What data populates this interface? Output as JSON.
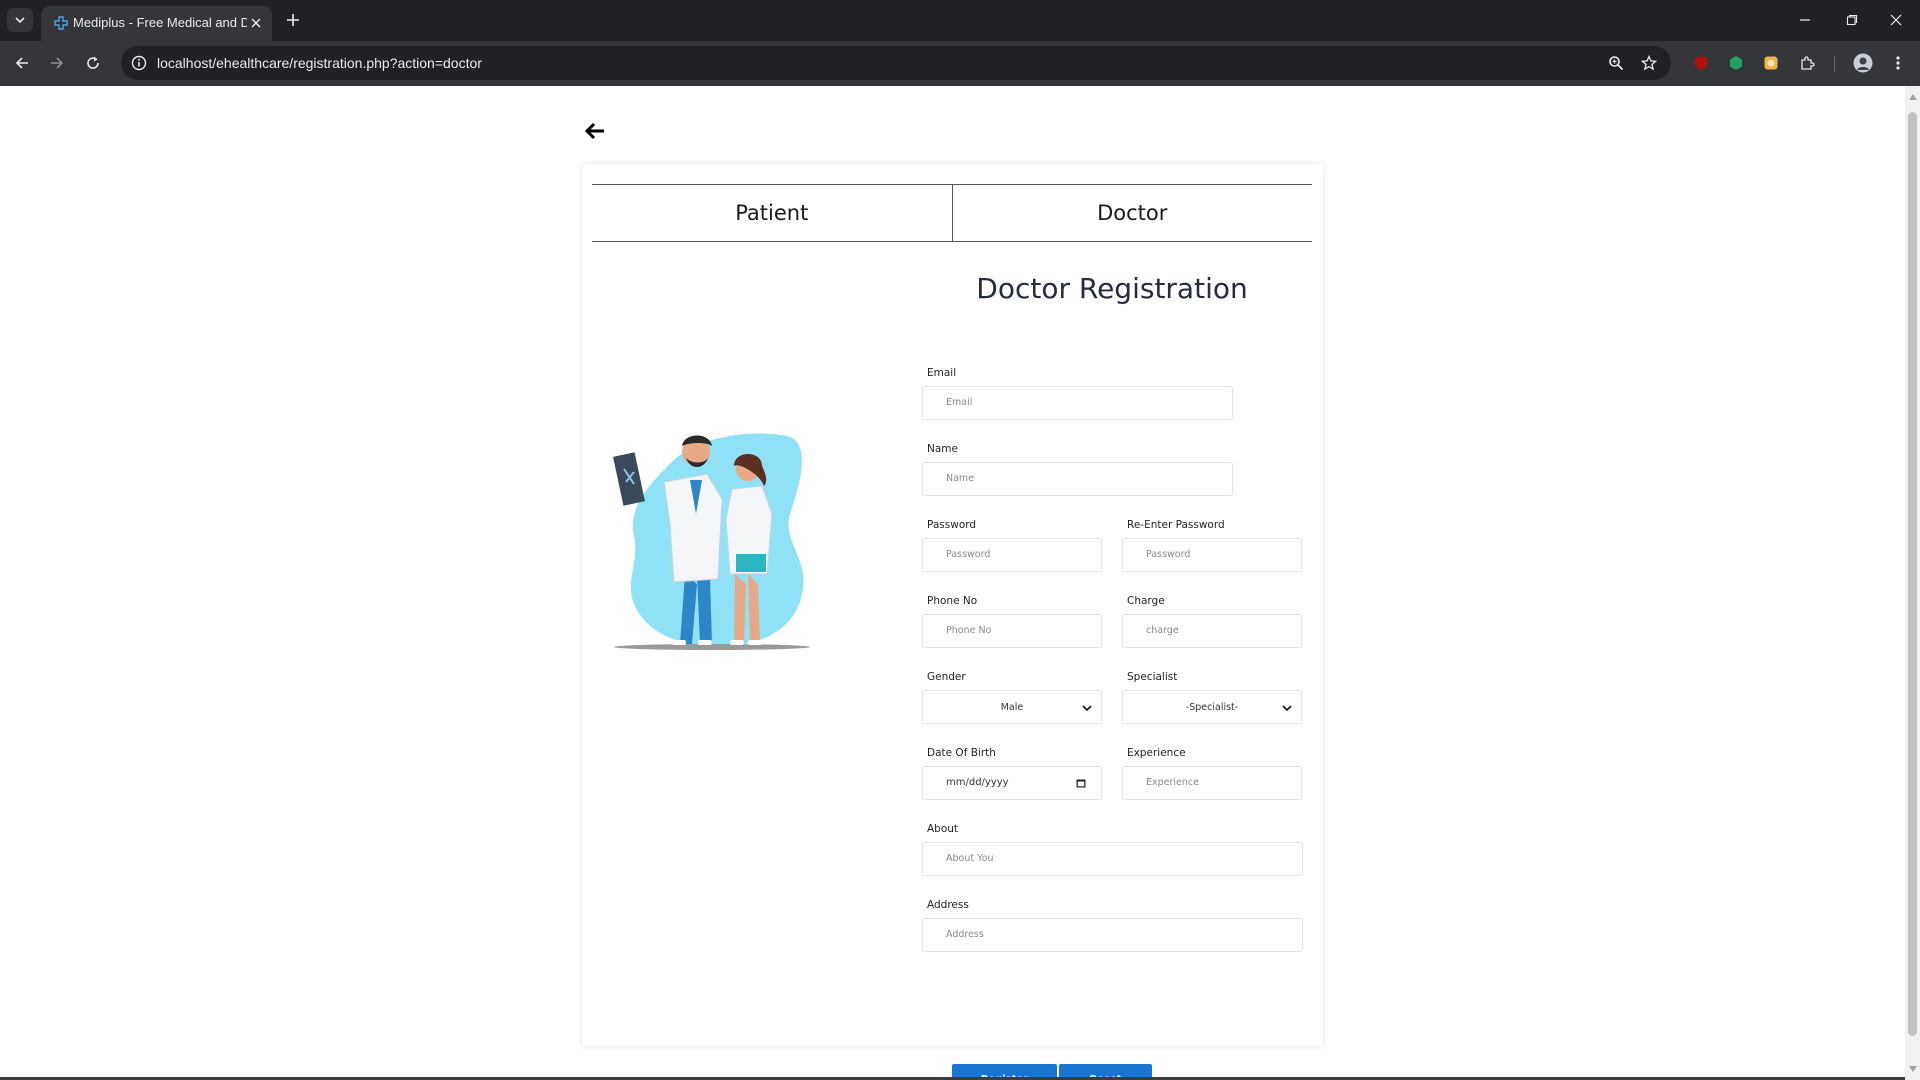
{
  "browser": {
    "tab_title": "Mediplus - Free Medical and Doctor Directory",
    "url": "localhost/ehealthcare/registration.php?action=doctor"
  },
  "page": {
    "role_tabs": [
      "Patient",
      "Doctor"
    ],
    "form_title": "Doctor Registration",
    "fields": {
      "email": {
        "label": "Email",
        "placeholder": "Email"
      },
      "name": {
        "label": "Name",
        "placeholder": "Name"
      },
      "password": {
        "label": "Password",
        "placeholder": "Password"
      },
      "reenter_password": {
        "label": "Re-Enter Password",
        "placeholder": "Password"
      },
      "phone": {
        "label": "Phone No",
        "placeholder": "Phone No"
      },
      "charge": {
        "label": "Charge",
        "placeholder": "charge"
      },
      "gender": {
        "label": "Gender",
        "value": "Male"
      },
      "specialist": {
        "label": "Specialist",
        "value": "-Specialist-"
      },
      "dob": {
        "label": "Date Of Birth",
        "value": "mm/dd/yyyy"
      },
      "experience": {
        "label": "Experience",
        "placeholder": "Experience"
      },
      "about": {
        "label": "About",
        "placeholder": "About You"
      },
      "address": {
        "label": "Address",
        "placeholder": "Address"
      }
    },
    "buttons": {
      "register": "Register",
      "reset": "Reset"
    }
  },
  "colors": {
    "accent": "#1a74d2",
    "title": "#262b3d",
    "illustration_blob": "#8fe1f5"
  },
  "icons": [
    "tab-list-icon",
    "favicon-icon",
    "close-icon",
    "plus-icon",
    "minimize-icon",
    "restore-icon",
    "back-icon",
    "forward-icon",
    "reload-icon",
    "info-icon",
    "zoom-icon",
    "star-icon",
    "extensions-icon",
    "profile-avatar",
    "menu-icon",
    "back-arrow-icon",
    "chevron-down-icon",
    "calendar-icon"
  ]
}
